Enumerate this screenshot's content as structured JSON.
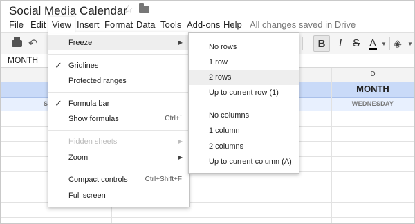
{
  "app": {
    "title": "Social Media Calendar",
    "status": "All changes saved in Drive"
  },
  "icons": {
    "star": "star-icon",
    "folder": "folder-icon",
    "print": "print-icon",
    "undo": "undo-icon",
    "bold": "bold-icon",
    "italic": "italic-icon",
    "strikethrough": "strikethrough-icon",
    "text_color": "text-color-icon",
    "fill_color": "fill-color-icon"
  },
  "menubar": {
    "items": [
      "File",
      "Edit",
      "View",
      "Insert",
      "Format",
      "Data",
      "Tools",
      "Add-ons",
      "Help"
    ],
    "active": "View"
  },
  "toolbar": {
    "bold": "B",
    "italic": "I",
    "strike": "S",
    "text_color": "A",
    "accent": "#000000"
  },
  "formula_bar": {
    "value": "MONTH"
  },
  "grid": {
    "column_header": "D",
    "month_cell": "MONTH",
    "day_cell": "WEDNESDAY",
    "day_cell_partial": "S",
    "header_color": "#c9daf8",
    "day_row_color": "#e8f0fe"
  },
  "view_menu": {
    "items": [
      {
        "label": "Freeze",
        "submenu": true
      },
      {
        "label": "Gridlines",
        "checked": true
      },
      {
        "label": "Protected ranges"
      },
      {
        "label": "Formula bar",
        "checked": true
      },
      {
        "label": "Show formulas",
        "shortcut": "Ctrl+`"
      },
      {
        "label": "Hidden sheets",
        "disabled": true,
        "submenu": true
      },
      {
        "label": "Zoom",
        "submenu": true
      },
      {
        "label": "Compact controls",
        "shortcut": "Ctrl+Shift+F"
      },
      {
        "label": "Full screen"
      }
    ]
  },
  "freeze_submenu": {
    "items": [
      "No rows",
      "1 row",
      "2 rows",
      "Up to current row (1)",
      "No columns",
      "1 column",
      "2 columns",
      "Up to current column (A)"
    ],
    "highlighted": "2 rows"
  }
}
